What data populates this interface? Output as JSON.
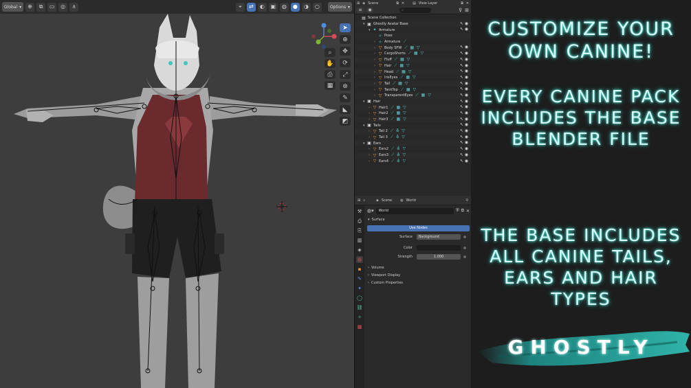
{
  "viewport": {
    "orientation": "Global",
    "options_label": "Options"
  },
  "outliner": {
    "header": {
      "scene": "Scene",
      "view_layer": "View Layer"
    },
    "search_placeholder": "",
    "rows": [
      {
        "label": "Scene Collection",
        "icon": "collection-icon",
        "glyph": "▤",
        "depth": 0,
        "chevron": "",
        "mods": "",
        "vis": ""
      },
      {
        "label": "Ghostly Avatar Base",
        "icon": "collection-icon",
        "glyph": "▣",
        "depth": 1,
        "chevron": "▾",
        "mods": "",
        "vis": "↖ ◉"
      },
      {
        "label": "Armature",
        "icon": "armature-icon",
        "glyph": "✦",
        "depth": 2,
        "chevron": "▾",
        "mods": "",
        "vis": "↖ ◉"
      },
      {
        "label": "Pose",
        "icon": "pose-icon",
        "glyph": "✧",
        "depth": 3,
        "chevron": "",
        "mods": "",
        "vis": ""
      },
      {
        "label": "Armature",
        "icon": "armature-data-icon",
        "glyph": "✧",
        "depth": 3,
        "chevron": "›",
        "mods": "⟋",
        "vis": ""
      },
      {
        "label": "Body SFW",
        "icon": "mesh-icon",
        "glyph": "▽",
        "depth": 3,
        "chevron": "›",
        "mods": "⟋ ▦ ▽",
        "vis": "↖ ◉"
      },
      {
        "label": "CargoShorts",
        "icon": "mesh-icon",
        "glyph": "▽",
        "depth": 3,
        "chevron": "›",
        "mods": "⟋ ▦ ▽",
        "vis": "↖ ◉"
      },
      {
        "label": "Fluff",
        "icon": "mesh-icon",
        "glyph": "▽",
        "depth": 3,
        "chevron": "›",
        "mods": "⟋ ▦ ▽",
        "vis": "↖ ◉"
      },
      {
        "label": "Hair",
        "icon": "mesh-icon",
        "glyph": "▽",
        "depth": 3,
        "chevron": "›",
        "mods": "⟋ ▦ ▽",
        "vis": "↖ ◉"
      },
      {
        "label": "Head",
        "icon": "mesh-icon",
        "glyph": "▽",
        "depth": 3,
        "chevron": "›",
        "mods": "⟋ ▦ ▽",
        "vis": "↖ ◉"
      },
      {
        "label": "IrisEyes",
        "icon": "mesh-icon",
        "glyph": "▽",
        "depth": 3,
        "chevron": "›",
        "mods": "⟋ ▦ ▽",
        "vis": "↖ ◉"
      },
      {
        "label": "Tail",
        "icon": "mesh-icon",
        "glyph": "▽",
        "depth": 3,
        "chevron": "›",
        "mods": "⟋ ▦ ▽",
        "vis": "↖ ◉"
      },
      {
        "label": "TankTop",
        "icon": "mesh-icon",
        "glyph": "▽",
        "depth": 3,
        "chevron": "›",
        "mods": "⟋ ▦ ▽",
        "vis": "↖ ◉"
      },
      {
        "label": "TransparentEyes",
        "icon": "mesh-icon",
        "glyph": "▽",
        "depth": 3,
        "chevron": "›",
        "mods": "⟋ ▦ ▽",
        "vis": "↖ ◉"
      },
      {
        "label": "Hair",
        "icon": "collection-icon",
        "glyph": "▣",
        "depth": 1,
        "chevron": "▾",
        "mods": "",
        "vis": "↖ ◉"
      },
      {
        "label": "Hair1",
        "icon": "mesh-icon",
        "glyph": "▽",
        "depth": 2,
        "chevron": "›",
        "mods": "⟋ ▦ ▽",
        "vis": "↖ ◉"
      },
      {
        "label": "Hair2",
        "icon": "mesh-icon",
        "glyph": "▽",
        "depth": 2,
        "chevron": "›",
        "mods": "⟋ ▦ ▽",
        "vis": "↖ ◉"
      },
      {
        "label": "Hair3",
        "icon": "mesh-icon",
        "glyph": "▽",
        "depth": 2,
        "chevron": "›",
        "mods": "⟋ ▦ ▽",
        "vis": "↖ ◉"
      },
      {
        "label": "Tails",
        "icon": "collection-icon",
        "glyph": "▣",
        "depth": 1,
        "chevron": "▾",
        "mods": "",
        "vis": "↖ ◉"
      },
      {
        "label": "Tail 2",
        "icon": "mesh-icon",
        "glyph": "▽",
        "depth": 2,
        "chevron": "›",
        "mods": "⟋ ⛢ ▽",
        "vis": "↖ ◉"
      },
      {
        "label": "Tail 3",
        "icon": "mesh-icon",
        "glyph": "▽",
        "depth": 2,
        "chevron": "›",
        "mods": "⟋ ⛢ ▽",
        "vis": "↖ ◉"
      },
      {
        "label": "Ears",
        "icon": "collection-icon",
        "glyph": "▣",
        "depth": 1,
        "chevron": "▾",
        "mods": "",
        "vis": "↖ ◉"
      },
      {
        "label": "Ears2",
        "icon": "mesh-icon",
        "glyph": "▽",
        "depth": 2,
        "chevron": "›",
        "mods": "⟋ ⛢ ▽",
        "vis": "↖ ◉"
      },
      {
        "label": "Ears3",
        "icon": "mesh-icon",
        "glyph": "▽",
        "depth": 2,
        "chevron": "›",
        "mods": "⟋ ⛢ ▽",
        "vis": "↖ ◉"
      },
      {
        "label": "Ears4",
        "icon": "mesh-icon",
        "glyph": "▽",
        "depth": 2,
        "chevron": "›",
        "mods": "⟋ ⛢ ▽",
        "vis": "↖ ◉"
      }
    ]
  },
  "properties": {
    "header": {
      "scene": "Scene",
      "world": "World"
    },
    "world_name": "World",
    "surface_section": "Surface",
    "use_nodes_label": "Use Nodes",
    "surface_label": "Surface",
    "surface_value": "Background",
    "color_label": "Color",
    "strength_label": "Strength",
    "strength_value": "1.000",
    "sections": [
      "Volume",
      "Viewport Display",
      "Custom Properties"
    ]
  },
  "promo": {
    "title": "CUSTOMIZE YOUR OWN CANINE!",
    "every": "EVERY CANINE PACK INCLUDES THE BASE BLENDER FILE",
    "base": "THE BASE INCLUDES ALL CANINE TAILS, EARS AND HAIR TYPES",
    "brand": "GHOSTLY"
  },
  "colors": {
    "accent": "#4772b3",
    "glow": "#5ef3e4",
    "brush": "#1e8f8a",
    "shirt": "#6b2b2e"
  }
}
